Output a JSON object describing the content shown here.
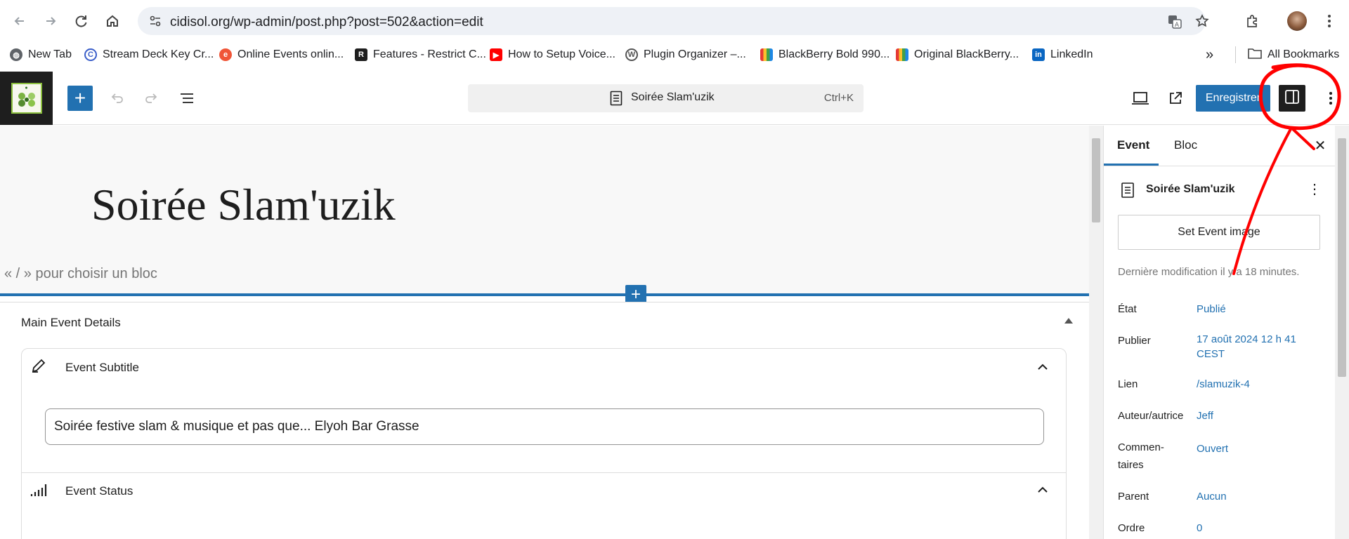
{
  "browser": {
    "url": "cidisol.org/wp-admin/post.php?post=502&action=edit",
    "bookmarks": [
      {
        "label": "New Tab",
        "icon": "globe-icon"
      },
      {
        "label": "Stream Deck Key Cr...",
        "icon": "stream-deck-icon"
      },
      {
        "label": "Online Events onlin...",
        "icon": "eventbrite-icon"
      },
      {
        "label": "Features - Restrict C...",
        "icon": "restrict-icon"
      },
      {
        "label": "How to Setup Voice...",
        "icon": "youtube-icon"
      },
      {
        "label": "Plugin Organizer –...",
        "icon": "wordpress-icon"
      },
      {
        "label": "BlackBerry Bold 990...",
        "icon": "shop-icon"
      },
      {
        "label": "Original BlackBerry...",
        "icon": "shop-icon"
      },
      {
        "label": "LinkedIn",
        "icon": "linkedin-icon"
      }
    ],
    "all_bookmarks": "All Bookmarks"
  },
  "editor": {
    "doc_title": "Soirée Slam'uzik",
    "shortcut": "Ctrl+K",
    "save_label": "Enregistrer"
  },
  "canvas": {
    "post_title": "Soirée Slam'uzik",
    "block_hint": "« / » pour choisir un bloc",
    "metabox_title": "Main Event Details",
    "subtitle_label": "Event Subtitle",
    "subtitle_value": "Soirée festive slam & musique et pas que... Elyoh Bar Grasse",
    "status_label": "Event Status"
  },
  "sidebar": {
    "tabs": [
      "Event",
      "Bloc"
    ],
    "post_title": "Soirée Slam'uzik",
    "set_image": "Set Event image",
    "modified": "Dernière modification il y a 18 minutes.",
    "rows": [
      {
        "label": "État",
        "value": "Publié"
      },
      {
        "label": "Publier",
        "value": "17 août 2024 12 h 41 CEST"
      },
      {
        "label": "Lien",
        "value": "/slamuzik-4"
      },
      {
        "label": "Auteur/autrice",
        "value": "Jeff"
      },
      {
        "label": "Commen-taires",
        "value": "Ouvert"
      },
      {
        "label": "Parent",
        "value": "Aucun"
      },
      {
        "label": "Ordre",
        "value": "0"
      }
    ]
  },
  "colors": {
    "accent": "#2271b1",
    "annotation": "#ff0000"
  }
}
